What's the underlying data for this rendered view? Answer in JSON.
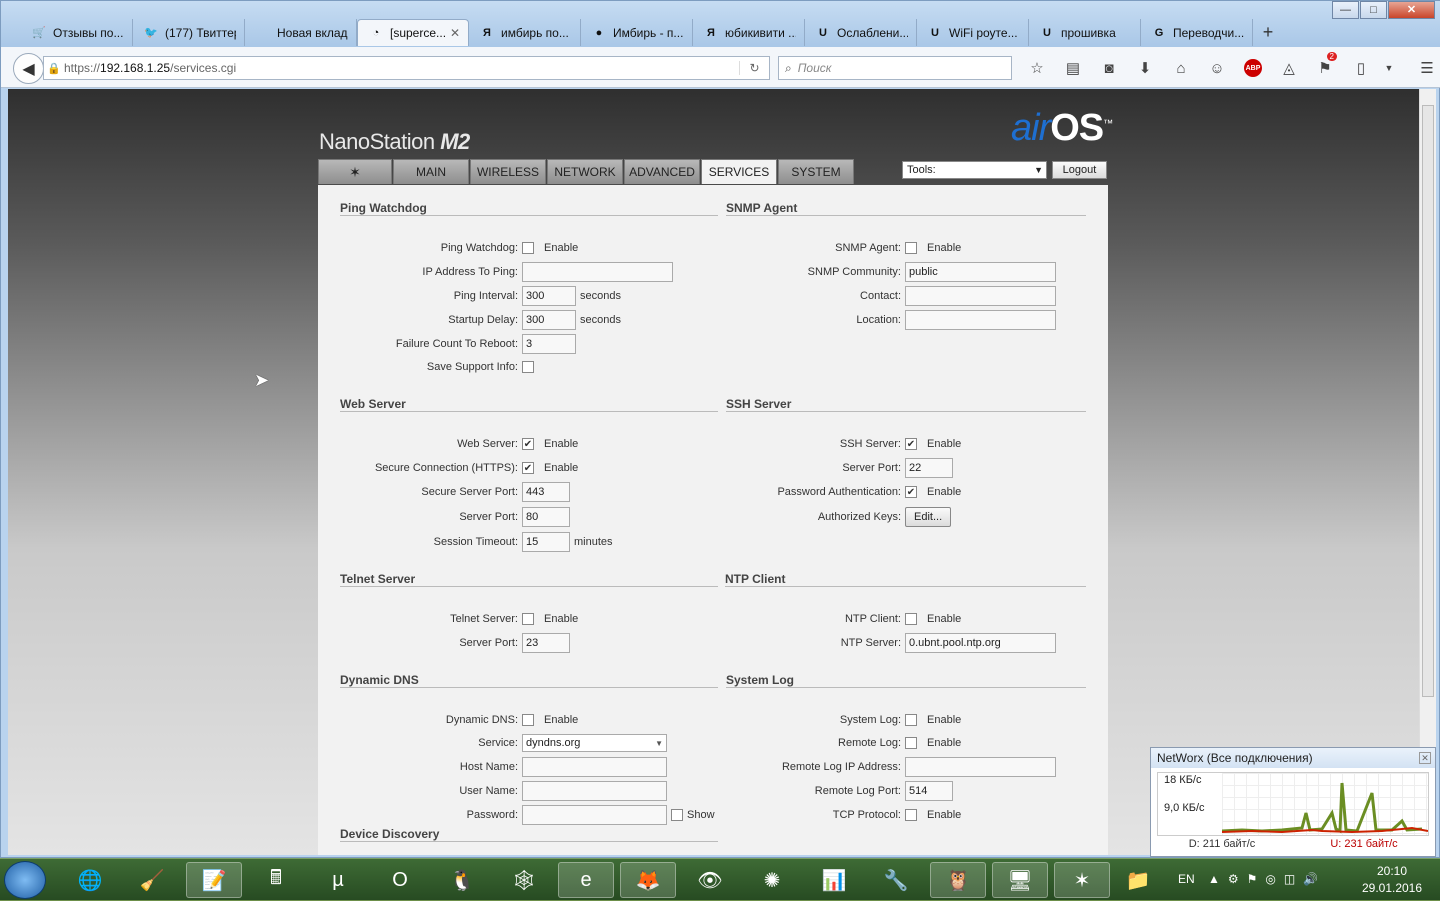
{
  "window_buttons": {
    "minimize": "—",
    "maximize": "□",
    "close": "✕"
  },
  "browser": {
    "tabs": [
      {
        "label": "Отзывы по...",
        "icon": "cart-icon",
        "glyph": "🛒"
      },
      {
        "label": "(177) Твиттер",
        "icon": "twitter-icon",
        "glyph": "🐦"
      },
      {
        "label": "Новая вкладка",
        "icon": "",
        "glyph": ""
      },
      {
        "label": "[superce...",
        "icon": "rss-icon",
        "glyph": "◔",
        "active": true
      },
      {
        "label": "имбирь по...",
        "icon": "yandex-icon",
        "glyph": "Я"
      },
      {
        "label": "Имбирь - п...",
        "icon": "ginger-icon",
        "glyph": "●"
      },
      {
        "label": "юбикивити ...",
        "icon": "yandex-icon",
        "glyph": "Я"
      },
      {
        "label": "Ослаблени...",
        "icon": "ubnt-icon",
        "glyph": "U"
      },
      {
        "label": "WiFi роуте...",
        "icon": "ubnt-icon",
        "glyph": "U"
      },
      {
        "label": "прошивка",
        "icon": "ubnt-icon",
        "glyph": "U"
      },
      {
        "label": "Переводчи...",
        "icon": "translate-icon",
        "glyph": "G"
      }
    ],
    "new_tab": "+",
    "tab_close": "✕",
    "url_prefix": "https://",
    "url_host": "192.168.1.25",
    "url_path": "/services.cgi",
    "search_placeholder": "Поиск",
    "abp_label": "ABP",
    "notification_count": "2"
  },
  "airos": {
    "product": "NanoStation",
    "model": "M2",
    "brand_air": "air",
    "brand_os": "OS",
    "brand_tm": "™",
    "tabs": [
      "MAIN",
      "WIRELESS",
      "NETWORK",
      "ADVANCED",
      "SERVICES",
      "SYSTEM"
    ],
    "active_tab": "SERVICES",
    "tools_label": "Tools:",
    "logout_label": "Logout"
  },
  "common": {
    "enable": "Enable",
    "seconds": "seconds",
    "minutes": "minutes",
    "show": "Show",
    "edit_button": "Edit..."
  },
  "ping_watchdog": {
    "title": "Ping Watchdog",
    "enabled_label": "Ping Watchdog:",
    "enabled": false,
    "ip_label": "IP Address To Ping:",
    "ip_value": "",
    "interval_label": "Ping Interval:",
    "interval_value": "300",
    "startup_label": "Startup Delay:",
    "startup_value": "300",
    "failure_label": "Failure Count To Reboot:",
    "failure_value": "3",
    "support_label": "Save Support Info:",
    "support": false
  },
  "snmp": {
    "title": "SNMP Agent",
    "enabled_label": "SNMP Agent:",
    "enabled": false,
    "community_label": "SNMP Community:",
    "community_value": "public",
    "contact_label": "Contact:",
    "contact_value": "",
    "location_label": "Location:",
    "location_value": ""
  },
  "web_server": {
    "title": "Web Server",
    "enabled_label": "Web Server:",
    "enabled": true,
    "https_label": "Secure Connection (HTTPS):",
    "https": true,
    "secure_port_label": "Secure Server Port:",
    "secure_port_value": "443",
    "port_label": "Server Port:",
    "port_value": "80",
    "timeout_label": "Session Timeout:",
    "timeout_value": "15"
  },
  "ssh": {
    "title": "SSH Server",
    "enabled_label": "SSH Server:",
    "enabled": true,
    "port_label": "Server Port:",
    "port_value": "22",
    "pwauth_label": "Password Authentication:",
    "pwauth": true,
    "keys_label": "Authorized Keys:"
  },
  "telnet": {
    "title": "Telnet Server",
    "enabled_label": "Telnet Server:",
    "enabled": false,
    "port_label": "Server Port:",
    "port_value": "23"
  },
  "ntp": {
    "title": "NTP Client",
    "enabled_label": "NTP Client:",
    "enabled": false,
    "server_label": "NTP Server:",
    "server_value": "0.ubnt.pool.ntp.org"
  },
  "ddns": {
    "title": "Dynamic DNS",
    "enabled_label": "Dynamic DNS:",
    "enabled": false,
    "service_label": "Service:",
    "service_value": "dyndns.org",
    "host_label": "Host Name:",
    "host_value": "",
    "user_label": "User Name:",
    "user_value": "",
    "password_label": "Password:",
    "password_value": ""
  },
  "syslog": {
    "title": "System Log",
    "enabled_label": "System Log:",
    "enabled": false,
    "remote_label": "Remote Log:",
    "remote": false,
    "remote_ip_label": "Remote Log IP Address:",
    "remote_ip_value": "",
    "remote_port_label": "Remote Log Port:",
    "remote_port_value": "514",
    "tcp_label": "TCP Protocol:",
    "tcp": false
  },
  "discovery": {
    "title": "Device Discovery"
  },
  "networx": {
    "title": "NetWorx (Все подключения)",
    "scale_top": "18 КБ/с",
    "scale_mid": "9,0 КБ/с",
    "download": "D: 211 байт/с",
    "upload": "U: 231 байт/с",
    "colors": {
      "download": "#6b8e23",
      "upload": "#cc2200"
    }
  },
  "taskbar": {
    "lang": "EN",
    "time": "20:10",
    "date": "29.01.2016"
  }
}
